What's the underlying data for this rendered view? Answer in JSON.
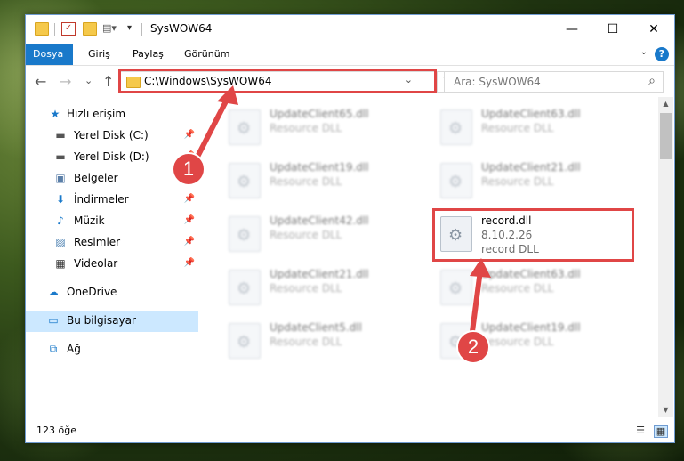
{
  "window": {
    "title": "SysWOW64"
  },
  "titlebar": {
    "minimize": "—",
    "maximize": "☐",
    "close": "✕"
  },
  "ribbon": {
    "tabs": [
      "Dosya",
      "Giriş",
      "Paylaş",
      "Görünüm"
    ],
    "help": "?"
  },
  "navbar": {
    "back": "←",
    "forward": "→",
    "recent": "⌄",
    "up": "↑",
    "address": "C:\\Windows\\SysWOW64",
    "search_placeholder": "Ara: SysWOW64"
  },
  "sidebar": {
    "quick_access": {
      "label": "Hızlı erişim",
      "icon": "star-icon"
    },
    "items": [
      {
        "label": "Yerel Disk (C:)",
        "icon": "drive-icon",
        "pinned": true
      },
      {
        "label": "Yerel Disk (D:)",
        "icon": "drive-icon",
        "pinned": true
      },
      {
        "label": "Belgeler",
        "icon": "documents-icon",
        "pinned": true
      },
      {
        "label": "İndirmeler",
        "icon": "download-icon",
        "pinned": true
      },
      {
        "label": "Müzik",
        "icon": "music-icon",
        "pinned": true
      },
      {
        "label": "Resimler",
        "icon": "pictures-icon",
        "pinned": true
      },
      {
        "label": "Videolar",
        "icon": "video-icon",
        "pinned": true
      }
    ],
    "onedrive": "OneDrive",
    "this_pc": "Bu bilgisayar",
    "network": "Ağ"
  },
  "files": [
    {
      "name": "UpdateClient65.dll",
      "desc": "Resource DLL",
      "blurred": true
    },
    {
      "name": "UpdateClient63.dll",
      "desc": "Resource DLL",
      "blurred": true
    },
    {
      "name": "UpdateClient19.dll",
      "desc": "Resource DLL",
      "blurred": true
    },
    {
      "name": "UpdateClient21.dll",
      "desc": "Resource DLL",
      "blurred": true
    },
    {
      "name": "UpdateClient42.dll",
      "desc": "Resource DLL",
      "blurred": true
    },
    {
      "name": "record.dll",
      "version": "8.10.2.26",
      "desc": "record DLL",
      "blurred": false
    },
    {
      "name": "UpdateClient21.dll",
      "desc": "Resource DLL",
      "blurred": true
    },
    {
      "name": "UpdateClient63.dll",
      "desc": "Resource DLL",
      "blurred": true
    },
    {
      "name": "UpdateClient5.dll",
      "desc": "Resource DLL",
      "blurred": true
    },
    {
      "name": "UpdateClient19.dll",
      "desc": "Resource DLL",
      "blurred": true
    }
  ],
  "status": {
    "item_count": "123 öğe"
  },
  "callouts": [
    "1",
    "2"
  ],
  "colors": {
    "accent": "#1979ca",
    "highlight": "#e04646",
    "selection": "#cce8ff"
  }
}
